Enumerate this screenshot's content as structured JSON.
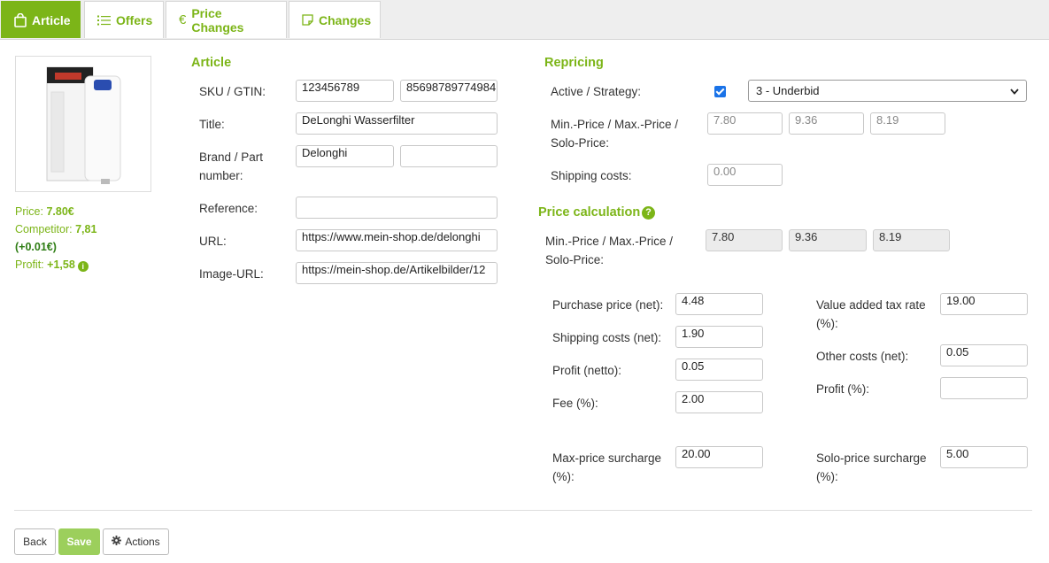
{
  "tabs": [
    {
      "label": "Article",
      "icon": "shopping-bag-icon",
      "active": true
    },
    {
      "label": "Offers",
      "icon": "list-icon"
    },
    {
      "label": "Price Changes",
      "icon": "euro-icon"
    },
    {
      "label": "Changes",
      "icon": "note-icon"
    }
  ],
  "price_info": {
    "price_label": "Price:",
    "price_value": "7.80€",
    "competitor_label": "Competitor:",
    "competitor_value": "7,81",
    "competitor_diff": "(+0.01€)",
    "profit_label": "Profit:",
    "profit_value": "+1,58",
    "info_glyph": "i"
  },
  "article": {
    "title": "Article",
    "sku_label": "SKU / GTIN:",
    "sku": "123456789",
    "gtin": "85698789774984",
    "title_label": "Title:",
    "title_value": "DeLonghi Wasserfilter",
    "brand_label": "Brand / Part number:",
    "brand": "Delonghi",
    "part_number": "",
    "reference_label": "Reference:",
    "reference": "",
    "url_label": "URL:",
    "url": "https://www.mein-shop.de/delonghi",
    "image_url_label": "Image-URL:",
    "image_url": "https://mein-shop.de/Artikelbilder/12"
  },
  "repricing": {
    "title": "Repricing",
    "active_label": "Active / Strategy:",
    "active": true,
    "strategy": "3 - Underbid",
    "minmax_label": "Min.-Price / Max.-Price / Solo-Price:",
    "min_price": "7.80",
    "max_price": "9.36",
    "solo_price": "8.19",
    "shipping_label": "Shipping costs:",
    "shipping": "0.00"
  },
  "calculation": {
    "title": "Price calculation",
    "help_glyph": "?",
    "minmax_label": "Min.-Price / Max.-Price / Solo-Price:",
    "min_price": "7.80",
    "max_price": "9.36",
    "solo_price": "8.19",
    "purchase_label": "Purchase price (net):",
    "purchase": "4.48",
    "shipping_net_label": "Shipping costs (net):",
    "shipping_net": "1.90",
    "profit_netto_label": "Profit (netto):",
    "profit_netto": "0.05",
    "fee_label": "Fee (%):",
    "fee": "2.00",
    "max_surcharge_label": "Max-price surcharge (%):",
    "max_surcharge": "20.00",
    "vat_label": "Value added tax rate (%):",
    "vat": "19.00",
    "other_costs_label": "Other costs (net):",
    "other_costs": "0.05",
    "profit_pct_label": "Profit (%):",
    "profit_pct": "",
    "solo_surcharge_label": "Solo-price surcharge (%):",
    "solo_surcharge": "5.00"
  },
  "footer": {
    "back": "Back",
    "save": "Save",
    "actions": "Actions"
  },
  "colors": {
    "accent": "#7cb518",
    "save_button": "#9ccf5c",
    "checkbox": "#1a73e8"
  }
}
